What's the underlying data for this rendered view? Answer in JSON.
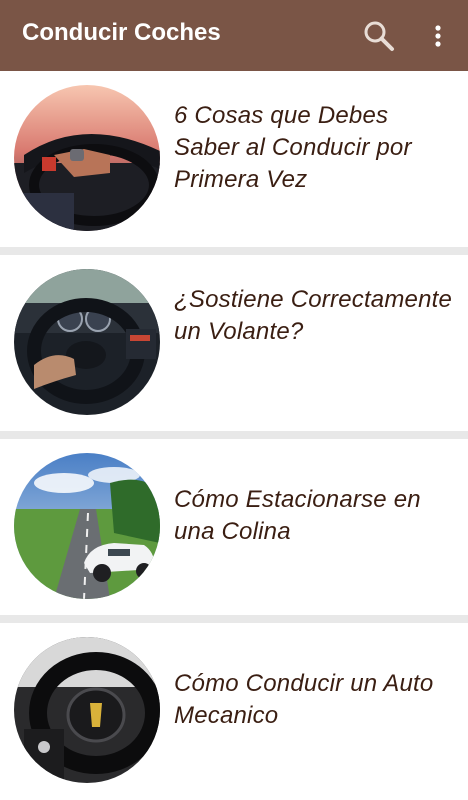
{
  "app_bar": {
    "title": "Conducir Coches",
    "background": "#7a5546",
    "actions": [
      {
        "icon": "search-icon"
      },
      {
        "icon": "overflow-menu-icon"
      }
    ]
  },
  "articles": [
    {
      "title": "6 Cosas que Debes Saber al Conducir por Primera Vez",
      "thumbnail": "hand-on-steering-wheel-sunset-photo"
    },
    {
      "title": "¿Sostiene Correctamente un Volante?",
      "thumbnail": "audi-dashboard-hand-photo"
    },
    {
      "title": "Cómo Estacionarse en una Colina",
      "thumbnail": "white-sports-car-on-road-photo"
    },
    {
      "title": "Cómo Conducir un Auto Mecanico",
      "thumbnail": "ferrari-steering-wheel-photo"
    }
  ],
  "colors": {
    "title_text": "#3a1e12",
    "divider": "#e8e8e8",
    "card_background": "#ffffff"
  }
}
